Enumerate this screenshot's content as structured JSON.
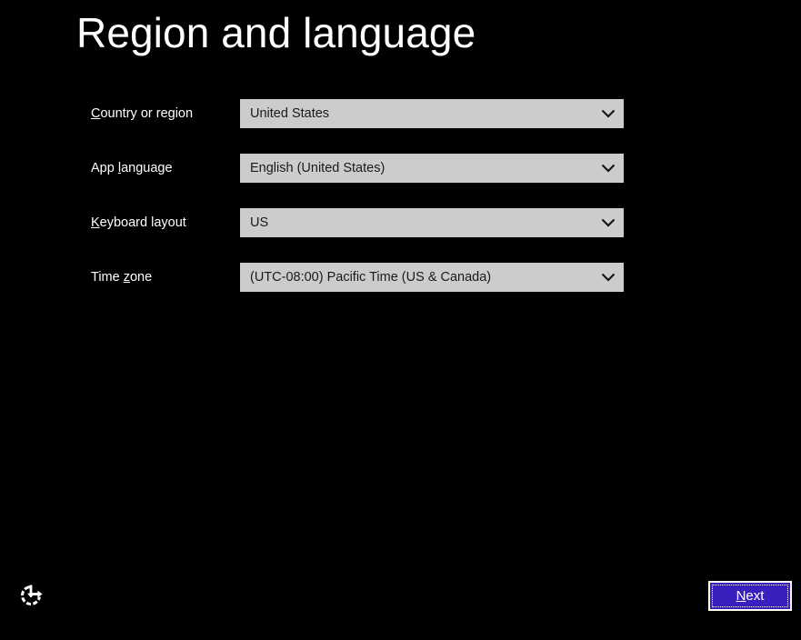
{
  "screen": {
    "title": "Region and language",
    "background_color": "#000000"
  },
  "form": {
    "rows": [
      {
        "label_prefix": "",
        "label_accesskey": "C",
        "label_suffix": "ountry or region",
        "field_name": "country-or-region",
        "value": "United States",
        "arrow_icon": "chevron-down-icon"
      },
      {
        "label_prefix": "App ",
        "label_accesskey": "l",
        "label_suffix": "anguage",
        "field_name": "app-language",
        "value": "English (United States)",
        "arrow_icon": "chevron-down-icon"
      },
      {
        "label_prefix": "",
        "label_accesskey": "K",
        "label_suffix": "eyboard layout",
        "field_name": "keyboard-layout",
        "value": "US",
        "arrow_icon": "chevron-down-icon"
      },
      {
        "label_prefix": "Time ",
        "label_accesskey": "z",
        "label_suffix": "one",
        "field_name": "time-zone",
        "value": "(UTC-08:00) Pacific Time (US & Canada)",
        "arrow_icon": "chevron-down-icon"
      }
    ],
    "combo_fill_color": "#cccccc",
    "combo_text_color": "#1a1a1a"
  },
  "footer": {
    "ease_of_access_icon": "ease-of-access-icon",
    "next": {
      "prefix": "",
      "accesskey": "N",
      "suffix": "ext",
      "fill_color": "#3a1fbe",
      "border_color": "#ffffff",
      "focused": true
    }
  }
}
